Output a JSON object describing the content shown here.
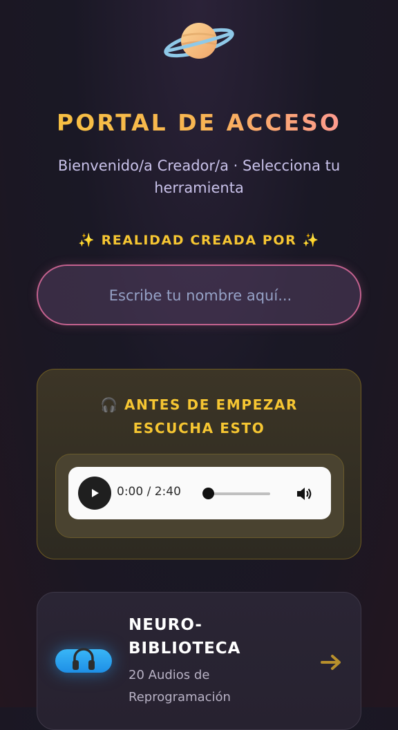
{
  "header": {
    "icon": "ringed-planet-icon",
    "title": "PORTAL DE ACCESO",
    "subtitle": "Bienvenido/a Creador/a · Selecciona tu herramienta"
  },
  "creator": {
    "label": "✨ REALIDAD CREADA POR ✨",
    "name_placeholder": "Escribe tu nombre aquí...",
    "name_value": ""
  },
  "audio": {
    "icon": "headphones-icon",
    "title_line1": "ANTES DE EMPEZAR",
    "title_line2": "ESCUCHA ESTO",
    "time_display": "0:00 / 2:40",
    "progress": 0,
    "controls": [
      "play-icon",
      "volume-icon"
    ]
  },
  "library": {
    "icon": "headphones-icon",
    "title": "NEURO-BIBLIOTECA",
    "description": "20 Audios de Reprogramación",
    "arrow_icon": "arrow-right-icon"
  },
  "colors": {
    "accent_gold": "#f6c632",
    "accent_pink": "#ff8fa8",
    "input_border": "#c4628f",
    "library_icon_blue": "#2aa2f0",
    "background": "#1b1822"
  }
}
